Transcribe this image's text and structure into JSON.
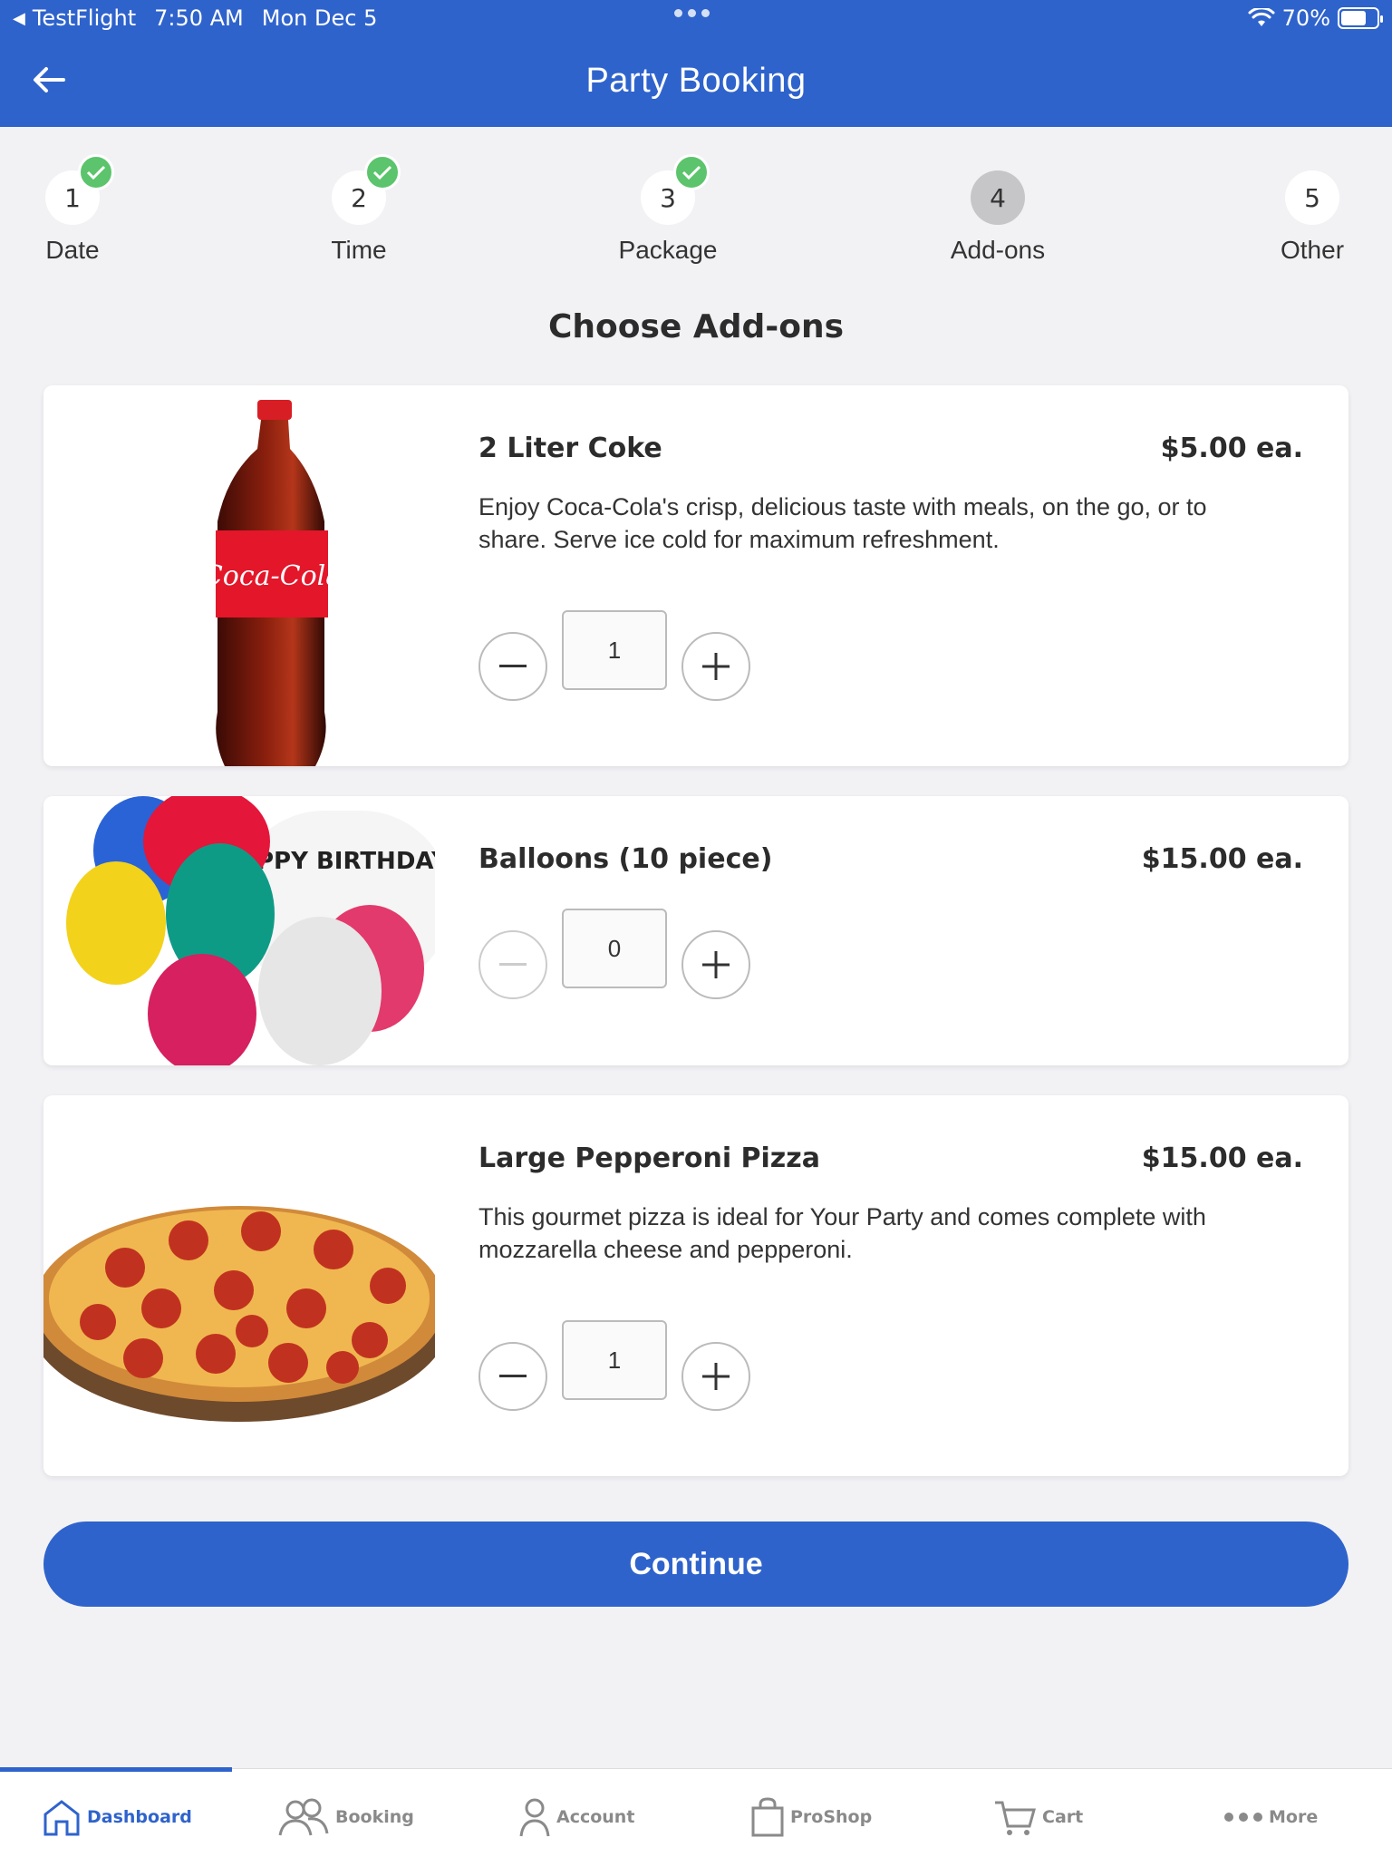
{
  "status_bar": {
    "app": "TestFlight",
    "time": "7:50 AM",
    "date": "Mon Dec 5",
    "battery": "70%",
    "battery_level": 0.7
  },
  "header": {
    "title": "Party Booking"
  },
  "steps": [
    {
      "num": "1",
      "label": "Date",
      "done": true
    },
    {
      "num": "2",
      "label": "Time",
      "done": true
    },
    {
      "num": "3",
      "label": "Package",
      "done": true
    },
    {
      "num": "4",
      "label": "Add-ons",
      "done": false,
      "active": true
    },
    {
      "num": "5",
      "label": "Other",
      "done": false
    }
  ],
  "section_title": "Choose Add-ons",
  "addons": [
    {
      "name": "2 Liter Coke",
      "price": "$5.00 ea.",
      "description": "Enjoy Coca-Cola's crisp, delicious taste with meals, on the go, or to share. Serve ice cold for maximum refreshment.",
      "quantity": "1",
      "image_label": "Coca-Cola"
    },
    {
      "name": "Balloons (10 piece)",
      "price": "$15.00 ea.",
      "description": "",
      "quantity": "0",
      "image_label": "HAPPY BIRTHDAY"
    },
    {
      "name": "Large Pepperoni Pizza",
      "price": "$15.00 ea.",
      "description": "This gourmet pizza is ideal for Your Party and comes complete with mozzarella cheese and pepperoni.",
      "quantity": "1"
    }
  ],
  "continue_label": "Continue",
  "tabs": [
    {
      "label": "Dashboard",
      "icon": "home-icon",
      "active": true
    },
    {
      "label": "Booking",
      "icon": "people-icon"
    },
    {
      "label": "Account",
      "icon": "person-icon"
    },
    {
      "label": "ProShop",
      "icon": "bag-icon"
    },
    {
      "label": "Cart",
      "icon": "cart-icon"
    },
    {
      "label": "More",
      "icon": "more-dots-icon"
    }
  ],
  "colors": {
    "primary": "#2f63cc",
    "check": "#5cc46c",
    "background": "#f2f2f5"
  }
}
